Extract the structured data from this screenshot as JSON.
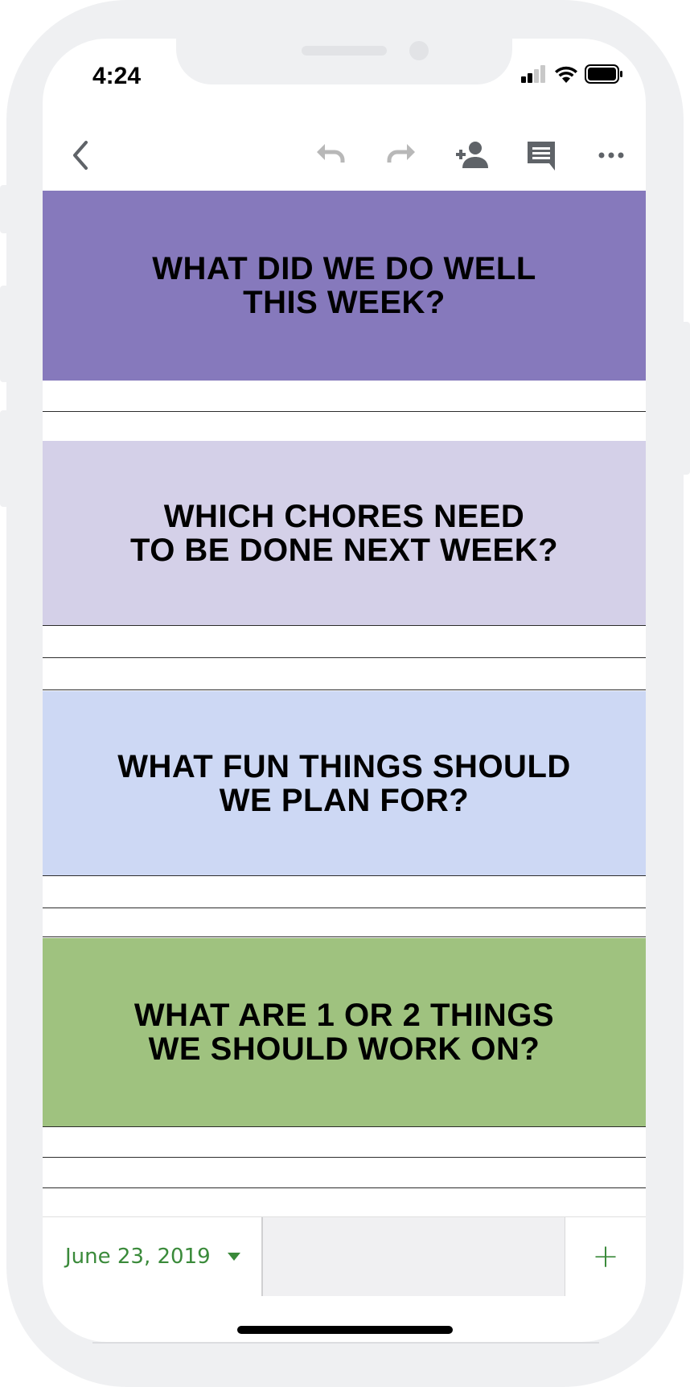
{
  "status": {
    "time": "4:24"
  },
  "toolbar": {
    "back_icon": "chevron-left-icon",
    "undo_icon": "undo-icon",
    "redo_icon": "redo-icon",
    "share_icon": "person-add-icon",
    "comment_icon": "comment-icon",
    "more_icon": "more-horizontal-icon"
  },
  "sections": [
    {
      "title": "WHAT DID WE DO WELL\nTHIS WEEK?",
      "color": "#8679bc"
    },
    {
      "title": "WHICH CHORES NEED\nTO BE DONE NEXT WEEK?",
      "color": "#d4d0e8"
    },
    {
      "title": "WHAT FUN THINGS SHOULD\nWE PLAN FOR?",
      "color": "#cdd8f4"
    },
    {
      "title": "WHAT ARE 1 OR 2 THINGS\nWE SHOULD WORK ON?",
      "color": "#9fc27f"
    }
  ],
  "sheet_tabs": {
    "active_label": "June 23, 2019",
    "accent_color": "#3a8a3a",
    "add_label": "+"
  }
}
